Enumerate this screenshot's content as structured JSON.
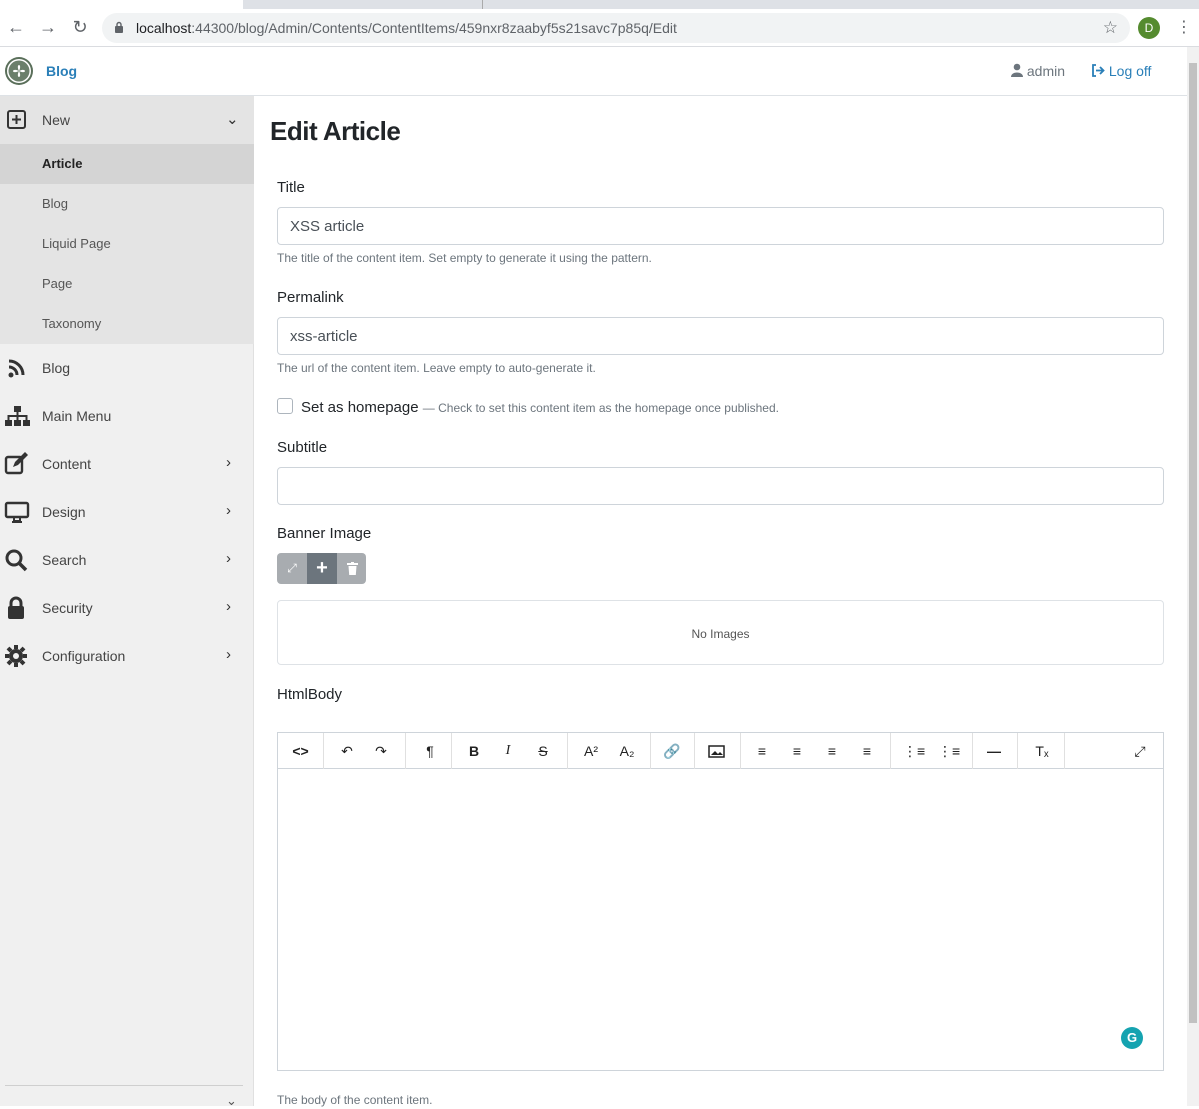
{
  "browser": {
    "url_host": "localhost",
    "url_path": ":44300/blog/Admin/Contents/ContentItems/459nxr8zaabyf5s21savc7p85q/Edit",
    "profile_initial": "D"
  },
  "header": {
    "brand": "Blog",
    "user": "admin",
    "logoff": "Log off"
  },
  "sidebar": {
    "new": {
      "label": "New",
      "items": [
        "Article",
        "Blog",
        "Liquid Page",
        "Page",
        "Taxonomy"
      ]
    },
    "items": [
      {
        "label": "Blog",
        "icon": "rss-icon"
      },
      {
        "label": "Main Menu",
        "icon": "sitemap-icon"
      },
      {
        "label": "Content",
        "icon": "edit-icon"
      },
      {
        "label": "Design",
        "icon": "desktop-icon"
      },
      {
        "label": "Search",
        "icon": "search-icon"
      },
      {
        "label": "Security",
        "icon": "lock-icon"
      },
      {
        "label": "Configuration",
        "icon": "cog-icon"
      }
    ]
  },
  "form": {
    "page_title": "Edit Article",
    "title": {
      "label": "Title",
      "value": "XSS article",
      "hint": "The title of the content item. Set empty to generate it using the pattern."
    },
    "permalink": {
      "label": "Permalink",
      "value": "xss-article",
      "hint": "The url of the content item. Leave empty to auto-generate it."
    },
    "homepage": {
      "label": "Set as homepage",
      "hint": "— Check to set this content item as the homepage once published."
    },
    "subtitle": {
      "label": "Subtitle",
      "value": ""
    },
    "banner": {
      "label": "Banner Image",
      "empty": "No Images"
    },
    "htmlbody": {
      "label": "HtmlBody",
      "hint": "The body of the content item."
    }
  },
  "colors": {
    "link": "#2a7fb8",
    "sidebar_bg": "#f0f0f0",
    "active_sub": "#d4d4d4"
  }
}
